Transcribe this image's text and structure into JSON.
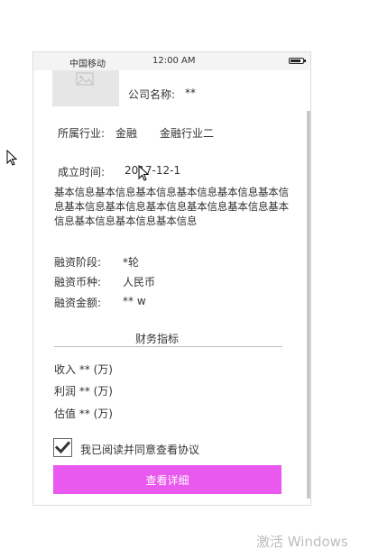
{
  "status_bar": {
    "carrier": "中国移动",
    "time": "12:00 AM"
  },
  "company": {
    "name_label": "公司名称:",
    "name_value": "**"
  },
  "industry": {
    "label": "所属行业:",
    "values": [
      "金融",
      "金融行业二"
    ]
  },
  "established": {
    "label": "成立时间:",
    "value": "2017-12-1"
  },
  "basic_info": "基本信息基本信息基本信息基本信息基本信息基本信息基本信息基本信息基本信息基本信息基本信息基本信息基本信息基本信息基本信息",
  "financing": {
    "stage_label": "融资阶段:",
    "stage_value": "*轮",
    "currency_label": "融资币种:",
    "currency_value": "人民币",
    "amount_label": "融资金额:",
    "amount_value": "** w"
  },
  "financial_indicators": {
    "title": "财务指标",
    "income": "收入 ** (万)",
    "profit": "利润 ** (万)",
    "valuation": "估值 ** (万)"
  },
  "agreement": {
    "checked": true,
    "label": "我已阅读并同意查看协议"
  },
  "detail_button_label": "查看详细",
  "watermark": "激活 Windows",
  "colors": {
    "button": "#e958ef",
    "divider": "#bbbbbb",
    "logo_placeholder": "#e6e6e6"
  },
  "icons": [
    "image-placeholder-icon",
    "battery-icon",
    "checkmark-icon",
    "mouse-cursor-icon"
  ]
}
